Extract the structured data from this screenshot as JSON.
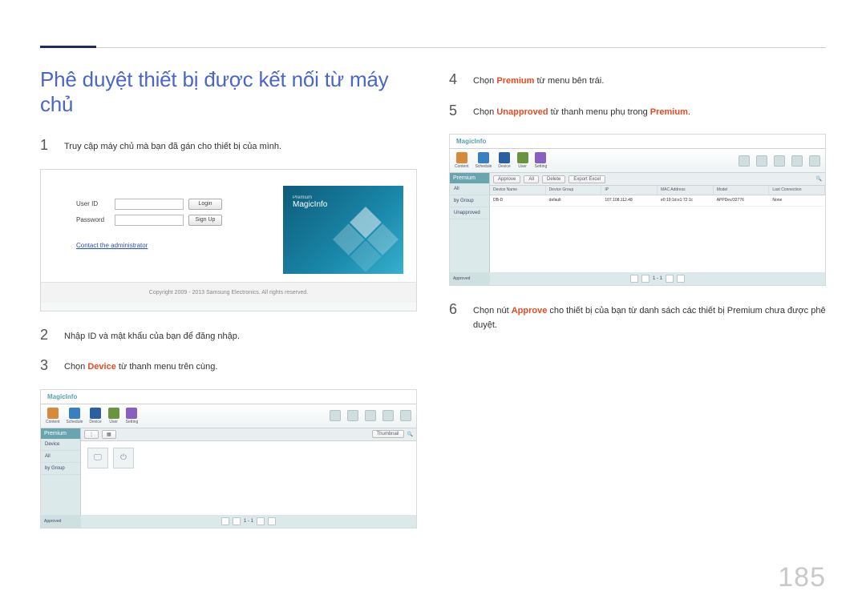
{
  "page_number": "185",
  "title": "Phê duyệt thiết bị được kết nối từ máy chủ",
  "left": {
    "step1": {
      "num": "1",
      "text": "Truy cập máy chủ mà bạn đã gán cho thiết bị của mình."
    },
    "step2": {
      "num": "2",
      "text": "Nhập ID và mật khẩu của bạn để đăng nhập."
    },
    "step3": {
      "num": "3",
      "pre": "Chọn ",
      "kw": "Device",
      "post": " từ thanh menu trên cùng."
    }
  },
  "right": {
    "step4": {
      "num": "4",
      "pre": "Chọn ",
      "kw": "Premium",
      "post": " từ menu bên trái."
    },
    "step5": {
      "num": "5",
      "pre": "Chọn ",
      "kw": "Unapproved",
      "post_pre": " từ thanh menu phụ trong ",
      "kw2": "Premium",
      "post": "."
    },
    "step6": {
      "num": "6",
      "pre": "Chọn nút ",
      "kw": "Approve",
      "post": " cho thiết bị của bạn từ danh sách các thiết bị Premium chưa được phê duyệt."
    }
  },
  "login": {
    "user_label": "User ID",
    "pass_label": "Password",
    "login_btn": "Login",
    "signup_btn": "Sign Up",
    "contact_link": "Contact the administrator",
    "copyright": "Copyright 2009 - 2013 Samsung Electronics. All rights reserved.",
    "banner_small": "Premium",
    "banner_title": "MagicInfo"
  },
  "mi": {
    "logo": "MagicInfo",
    "tool_content": "Content",
    "tool_schedule": "Schedule",
    "tool_device": "Device",
    "tool_user": "User",
    "tool_setting": "Setting",
    "side_head": "Premium",
    "side_all": "All",
    "side_device": "Device",
    "side_group": "by Group",
    "side_unapproved": "Unapproved",
    "sub_approve": "Approve",
    "sub_all": "All",
    "sub_delete": "Delete",
    "sub_export": "Export Excel",
    "th_name": "Device Name",
    "th_group": "Device Group",
    "th_ip": "IP",
    "th_mac": "MAC Address",
    "th_model": "Model",
    "th_time": "Last Connection",
    "row_name": "DB-D",
    "row_group": "default",
    "row_ip": "107.108.112.48",
    "row_mac": "e0:19:1d:e1:72:1c",
    "row_model": "APPDev/32776",
    "row_time": "None",
    "page_display": "1 - 1",
    "approved": "Approved"
  }
}
